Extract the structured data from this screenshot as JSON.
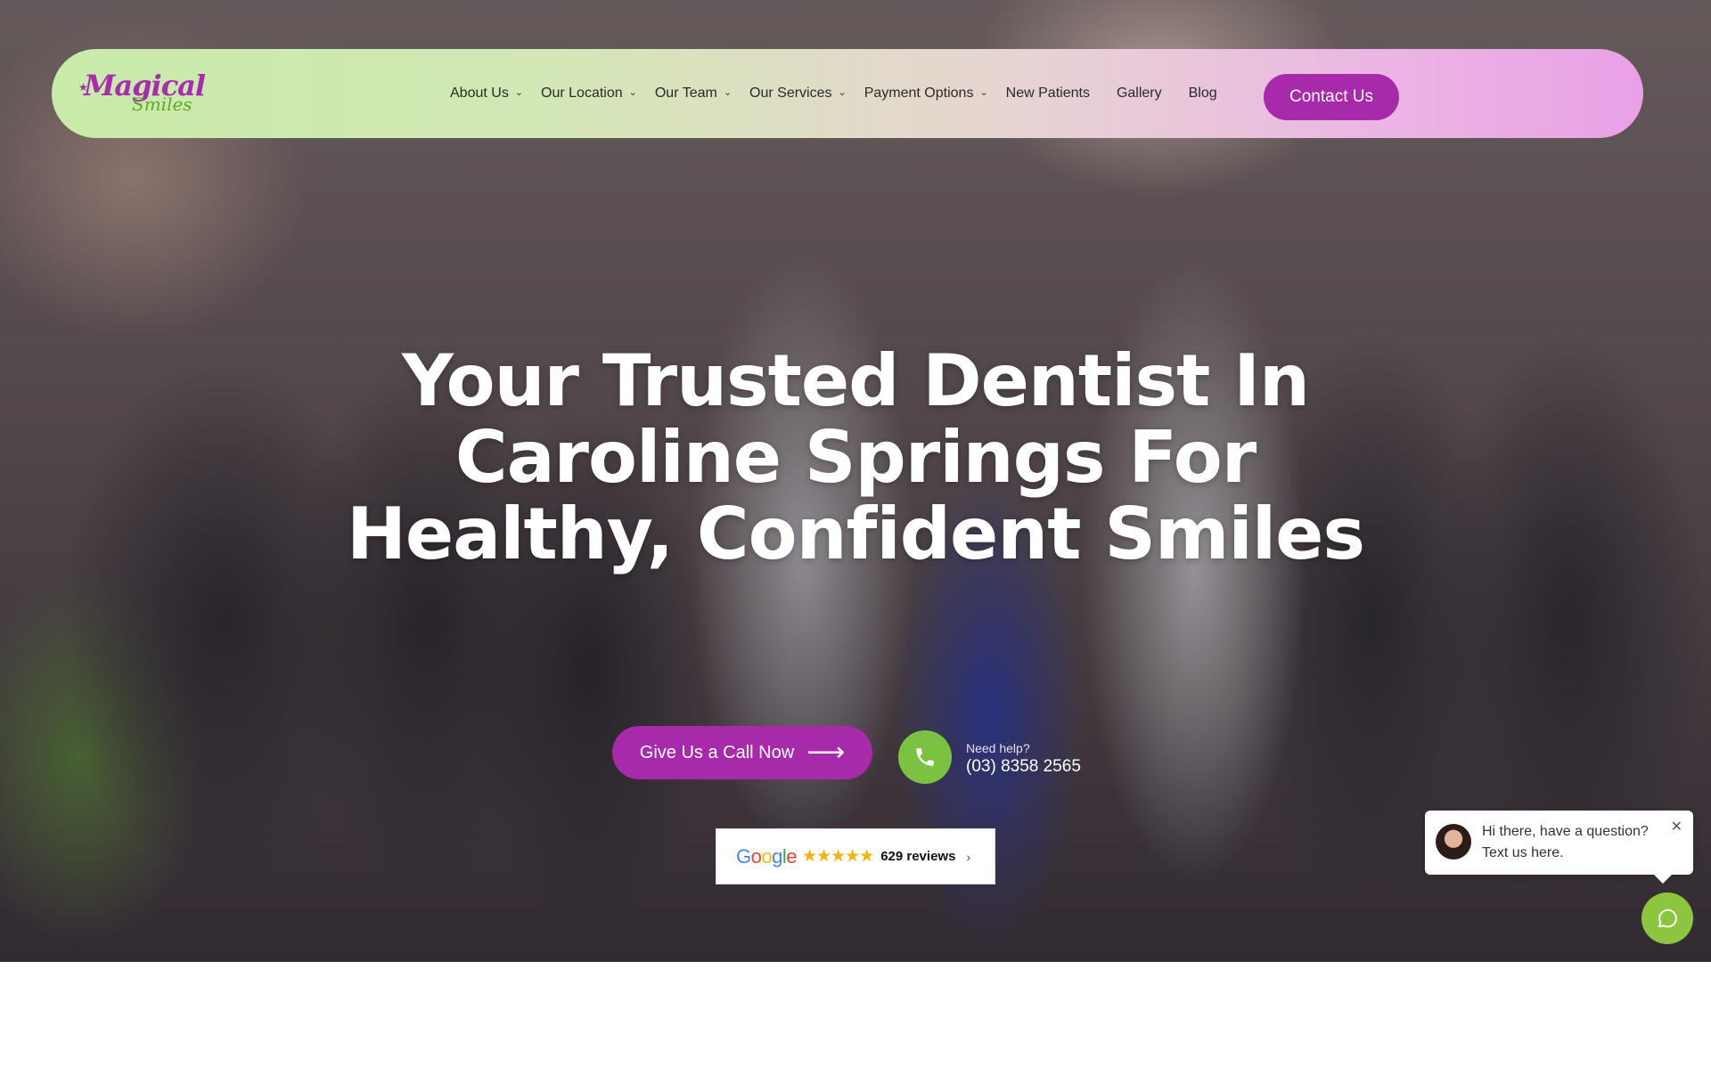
{
  "brand": {
    "logo_line1": "Magical",
    "logo_line2": "Smiles",
    "accent_color": "#a62aaa",
    "secondary_color": "#7cc242"
  },
  "nav": {
    "items": [
      {
        "label": "About Us",
        "has_dropdown": true
      },
      {
        "label": "Our Location",
        "has_dropdown": true
      },
      {
        "label": "Our Team",
        "has_dropdown": true
      },
      {
        "label": "Our Services",
        "has_dropdown": true
      },
      {
        "label": "Payment Options",
        "has_dropdown": true
      },
      {
        "label": "New Patients",
        "has_dropdown": false
      },
      {
        "label": "Gallery",
        "has_dropdown": false
      },
      {
        "label": "Blog",
        "has_dropdown": false
      }
    ],
    "contact_label": "Contact Us"
  },
  "hero": {
    "headline": "Your Trusted Dentist In Caroline Springs For Healthy, Confident Smiles",
    "call_button_label": "Give Us a Call Now",
    "need_help": "Need help?",
    "phone": "(03) 8358 2565"
  },
  "reviews": {
    "provider": "Google",
    "stars": "★★★★★",
    "count_text": "629 reviews"
  },
  "chat": {
    "message": "Hi there, have a question? Text us here.",
    "icons": [
      "avatar",
      "close-icon",
      "chat-icon"
    ]
  }
}
